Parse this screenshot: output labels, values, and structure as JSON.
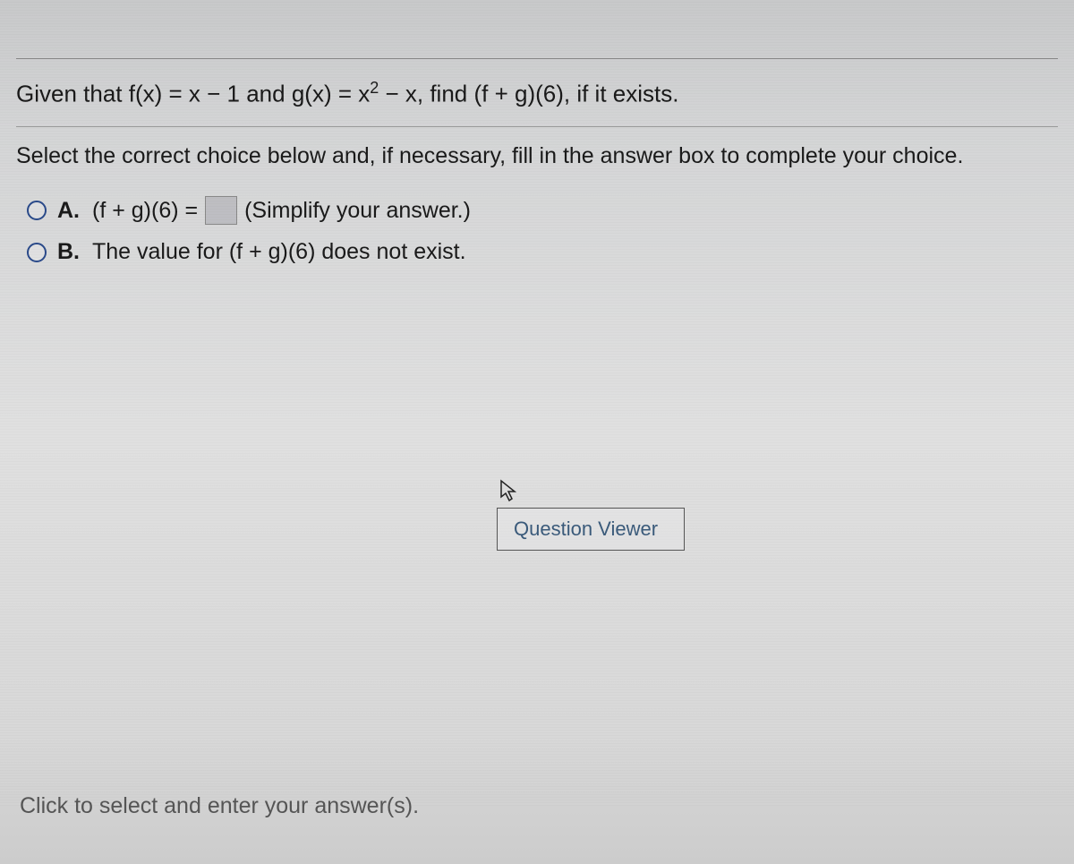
{
  "question": {
    "given_prefix": "Given that f(x) = x − 1 and g(x) = x",
    "given_exponent": "2",
    "given_suffix": " − x, find (f + g)(6), if it exists."
  },
  "instruction": "Select the correct choice below and, if necessary, fill in the answer box to complete your choice.",
  "choices": {
    "a": {
      "label": "A.",
      "prefix": "(f + g)(6) =",
      "suffix": "(Simplify your answer.)"
    },
    "b": {
      "label": "B.",
      "text": "The value for (f + g)(6) does not exist."
    }
  },
  "tooltip": "Question Viewer",
  "footer": "Click to select and enter your answer(s)."
}
